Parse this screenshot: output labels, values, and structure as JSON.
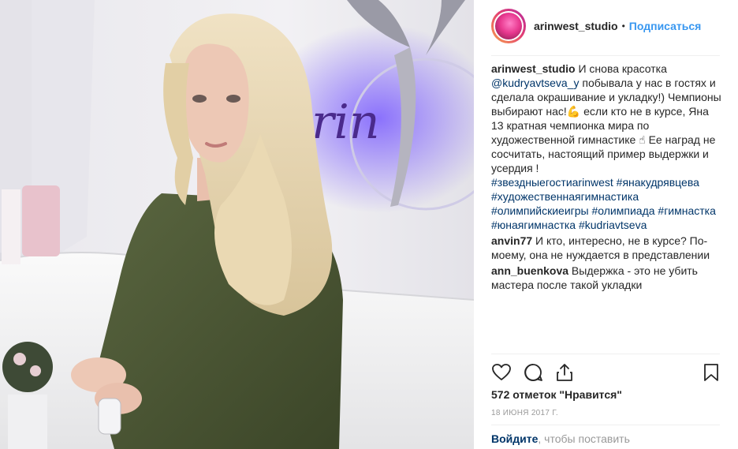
{
  "post": {
    "username": "arinwest_studio",
    "follow_label": "Подписаться",
    "separator": "•",
    "caption": {
      "user": "arinwest_studio",
      "text_1": " И снова красотка ",
      "mention": "@kudryavtseva_y",
      "text_2": " побывала у нас в гостях и сделала окрашивание и укладку!) Чемпионы выбирают нас!💪 если кто не в курсе, Яна 13 кратная чемпионка мира по художественной гимнастике ☝ Ее наград не сосчитать, настоящий пример выдержки и усердия ! ",
      "hashtags": "#звездныегостиarinwest #янакудрявцева #художественнаягимнастика #олимпийскиеигры #олимпиада #гимнастка #юнаягимнастка #kudriavtseva"
    },
    "comments": [
      {
        "user": "anvin77",
        "text": " И кто, интересно, не в курсе? По-моему, она не нуждается в представлении"
      },
      {
        "user": "ann_buenkova",
        "text": " Выдержка - это не убить мастера после такой укладки"
      }
    ],
    "likes": "572 отметок \"Нравится\"",
    "date": "18 июня 2017 г.",
    "login_link": "Войдите",
    "login_text": ", чтобы поставить"
  },
  "icons": {
    "like": "heart-icon",
    "comment": "comment-bubble-icon",
    "share": "share-icon",
    "save": "bookmark-icon"
  },
  "colors": {
    "link_blue": "#3897f0",
    "hashtag": "#003569",
    "muted": "#999999",
    "neon_sign": "#7b68ee"
  }
}
